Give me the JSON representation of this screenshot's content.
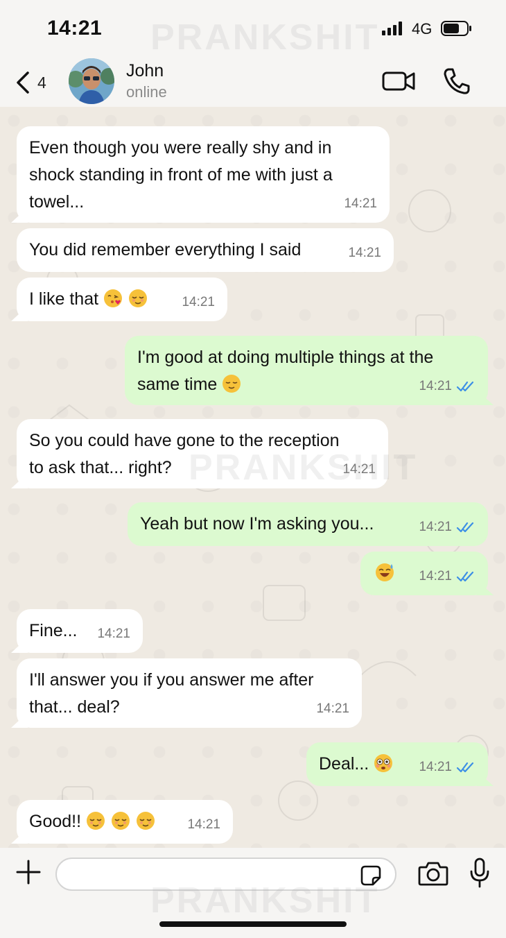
{
  "status_bar": {
    "time": "14:21",
    "network": "4G"
  },
  "watermark": "PRANKSHIT",
  "header": {
    "back_count": "4",
    "contact_name": "John",
    "contact_status": "online"
  },
  "messages": [
    {
      "dir": "in",
      "text": "Even though you were really shy and in\nshock standing in front of me with just a\ntowel...",
      "time": "14:21"
    },
    {
      "dir": "in",
      "text": "You did remember everything I said",
      "time": "14:21"
    },
    {
      "dir": "in",
      "text": "I like that",
      "time": "14:21",
      "emojis": [
        "kissing-heart-emoji",
        "relieved-emoji"
      ]
    },
    {
      "dir": "out",
      "text": "I'm good at doing multiple things at the\nsame time",
      "time": "14:21",
      "emojis": [
        "pensive-smile-emoji"
      ],
      "status": "read"
    },
    {
      "dir": "in",
      "text": "So you could have gone to the reception\nto ask that... right?",
      "time": "14:21"
    },
    {
      "dir": "out",
      "text": "Yeah but now I'm asking you...",
      "time": "14:21",
      "status": "read"
    },
    {
      "dir": "out",
      "text": "",
      "time": "14:21",
      "emojis": [
        "sweat-smile-emoji"
      ],
      "status": "read"
    },
    {
      "dir": "in",
      "text": "Fine...",
      "time": "14:21"
    },
    {
      "dir": "in",
      "text": "I'll answer you if you answer me after\nthat... deal?",
      "time": "14:21"
    },
    {
      "dir": "out",
      "text": "Deal...",
      "time": "14:21",
      "emojis": [
        "flushed-emoji"
      ],
      "status": "read"
    },
    {
      "dir": "in",
      "text": "Good!!",
      "time": "14:21",
      "emojis": [
        "relieved-emoji",
        "relieved-emoji",
        "relieved-emoji"
      ]
    }
  ],
  "input": {
    "placeholder": "",
    "value": ""
  },
  "colors": {
    "incoming_bubble": "#ffffff",
    "outgoing_bubble": "#dcfad0",
    "read_ticks": "#3b8ee6",
    "chat_background": "#efeae2"
  }
}
